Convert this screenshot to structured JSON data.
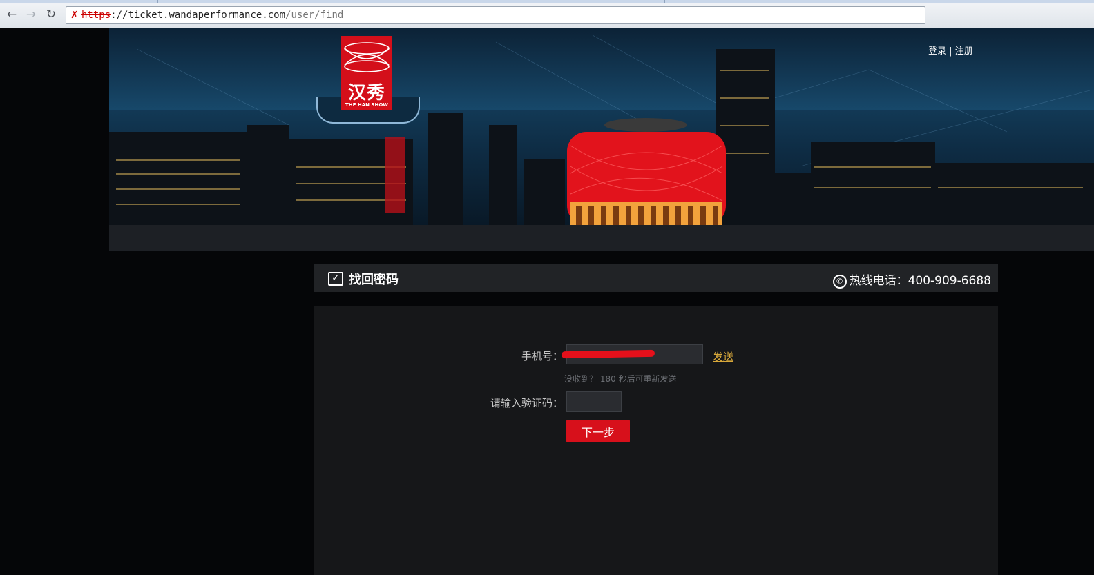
{
  "browser": {
    "url_scheme": "https",
    "url_rest": "://ticket.wandaperformance.com",
    "url_path": "/user/find"
  },
  "header": {
    "logo_cn": "汉秀",
    "logo_en": "THE HAN SHOW",
    "login": "登录",
    "separator": "|",
    "register": "注册"
  },
  "section": {
    "title": "找回密码",
    "hotline_label": "热线电话：",
    "hotline_number": "400-909-6688"
  },
  "form": {
    "phone_label": "手机号：",
    "phone_value": "1",
    "send_link": "发送",
    "resend_hint": "没收到？ 180 秒后可重新发送",
    "code_label": "请输入验证码：",
    "code_value": "",
    "next_button": "下一步"
  },
  "colors": {
    "brand_red": "#d7101b",
    "link_gold": "#d8a83a",
    "panel_bg": "#161719"
  }
}
